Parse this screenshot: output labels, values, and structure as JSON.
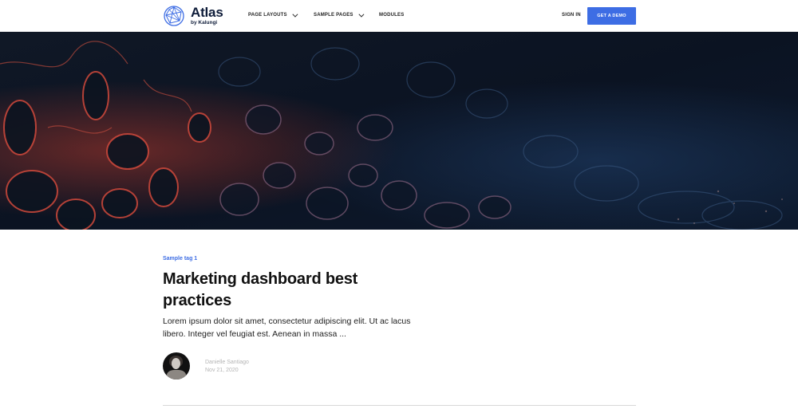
{
  "brand": {
    "title": "Atlas",
    "subtitle": "by Kalungi",
    "accent": "#3d6de4"
  },
  "nav": {
    "items": [
      {
        "label": "PAGE LAYOUTS",
        "has_dropdown": true
      },
      {
        "label": "SAMPLE PAGES",
        "has_dropdown": true
      },
      {
        "label": "MODULES",
        "has_dropdown": false
      }
    ],
    "sign_in": "SIGN IN",
    "cta": "GET A DEMO"
  },
  "article": {
    "tag": "Sample tag 1",
    "title": "Marketing dashboard best practices",
    "excerpt": "Lorem ipsum dolor sit amet, consectetur adipiscing elit. Ut ac lacus libero. Integer vel feugiat est. Aenean in massa ...",
    "author": {
      "name": "Danielle Santiago",
      "date": "Nov 21, 2020"
    }
  },
  "icons": {
    "logo": "globe-network-icon",
    "dropdown": "chevron-down-icon"
  }
}
